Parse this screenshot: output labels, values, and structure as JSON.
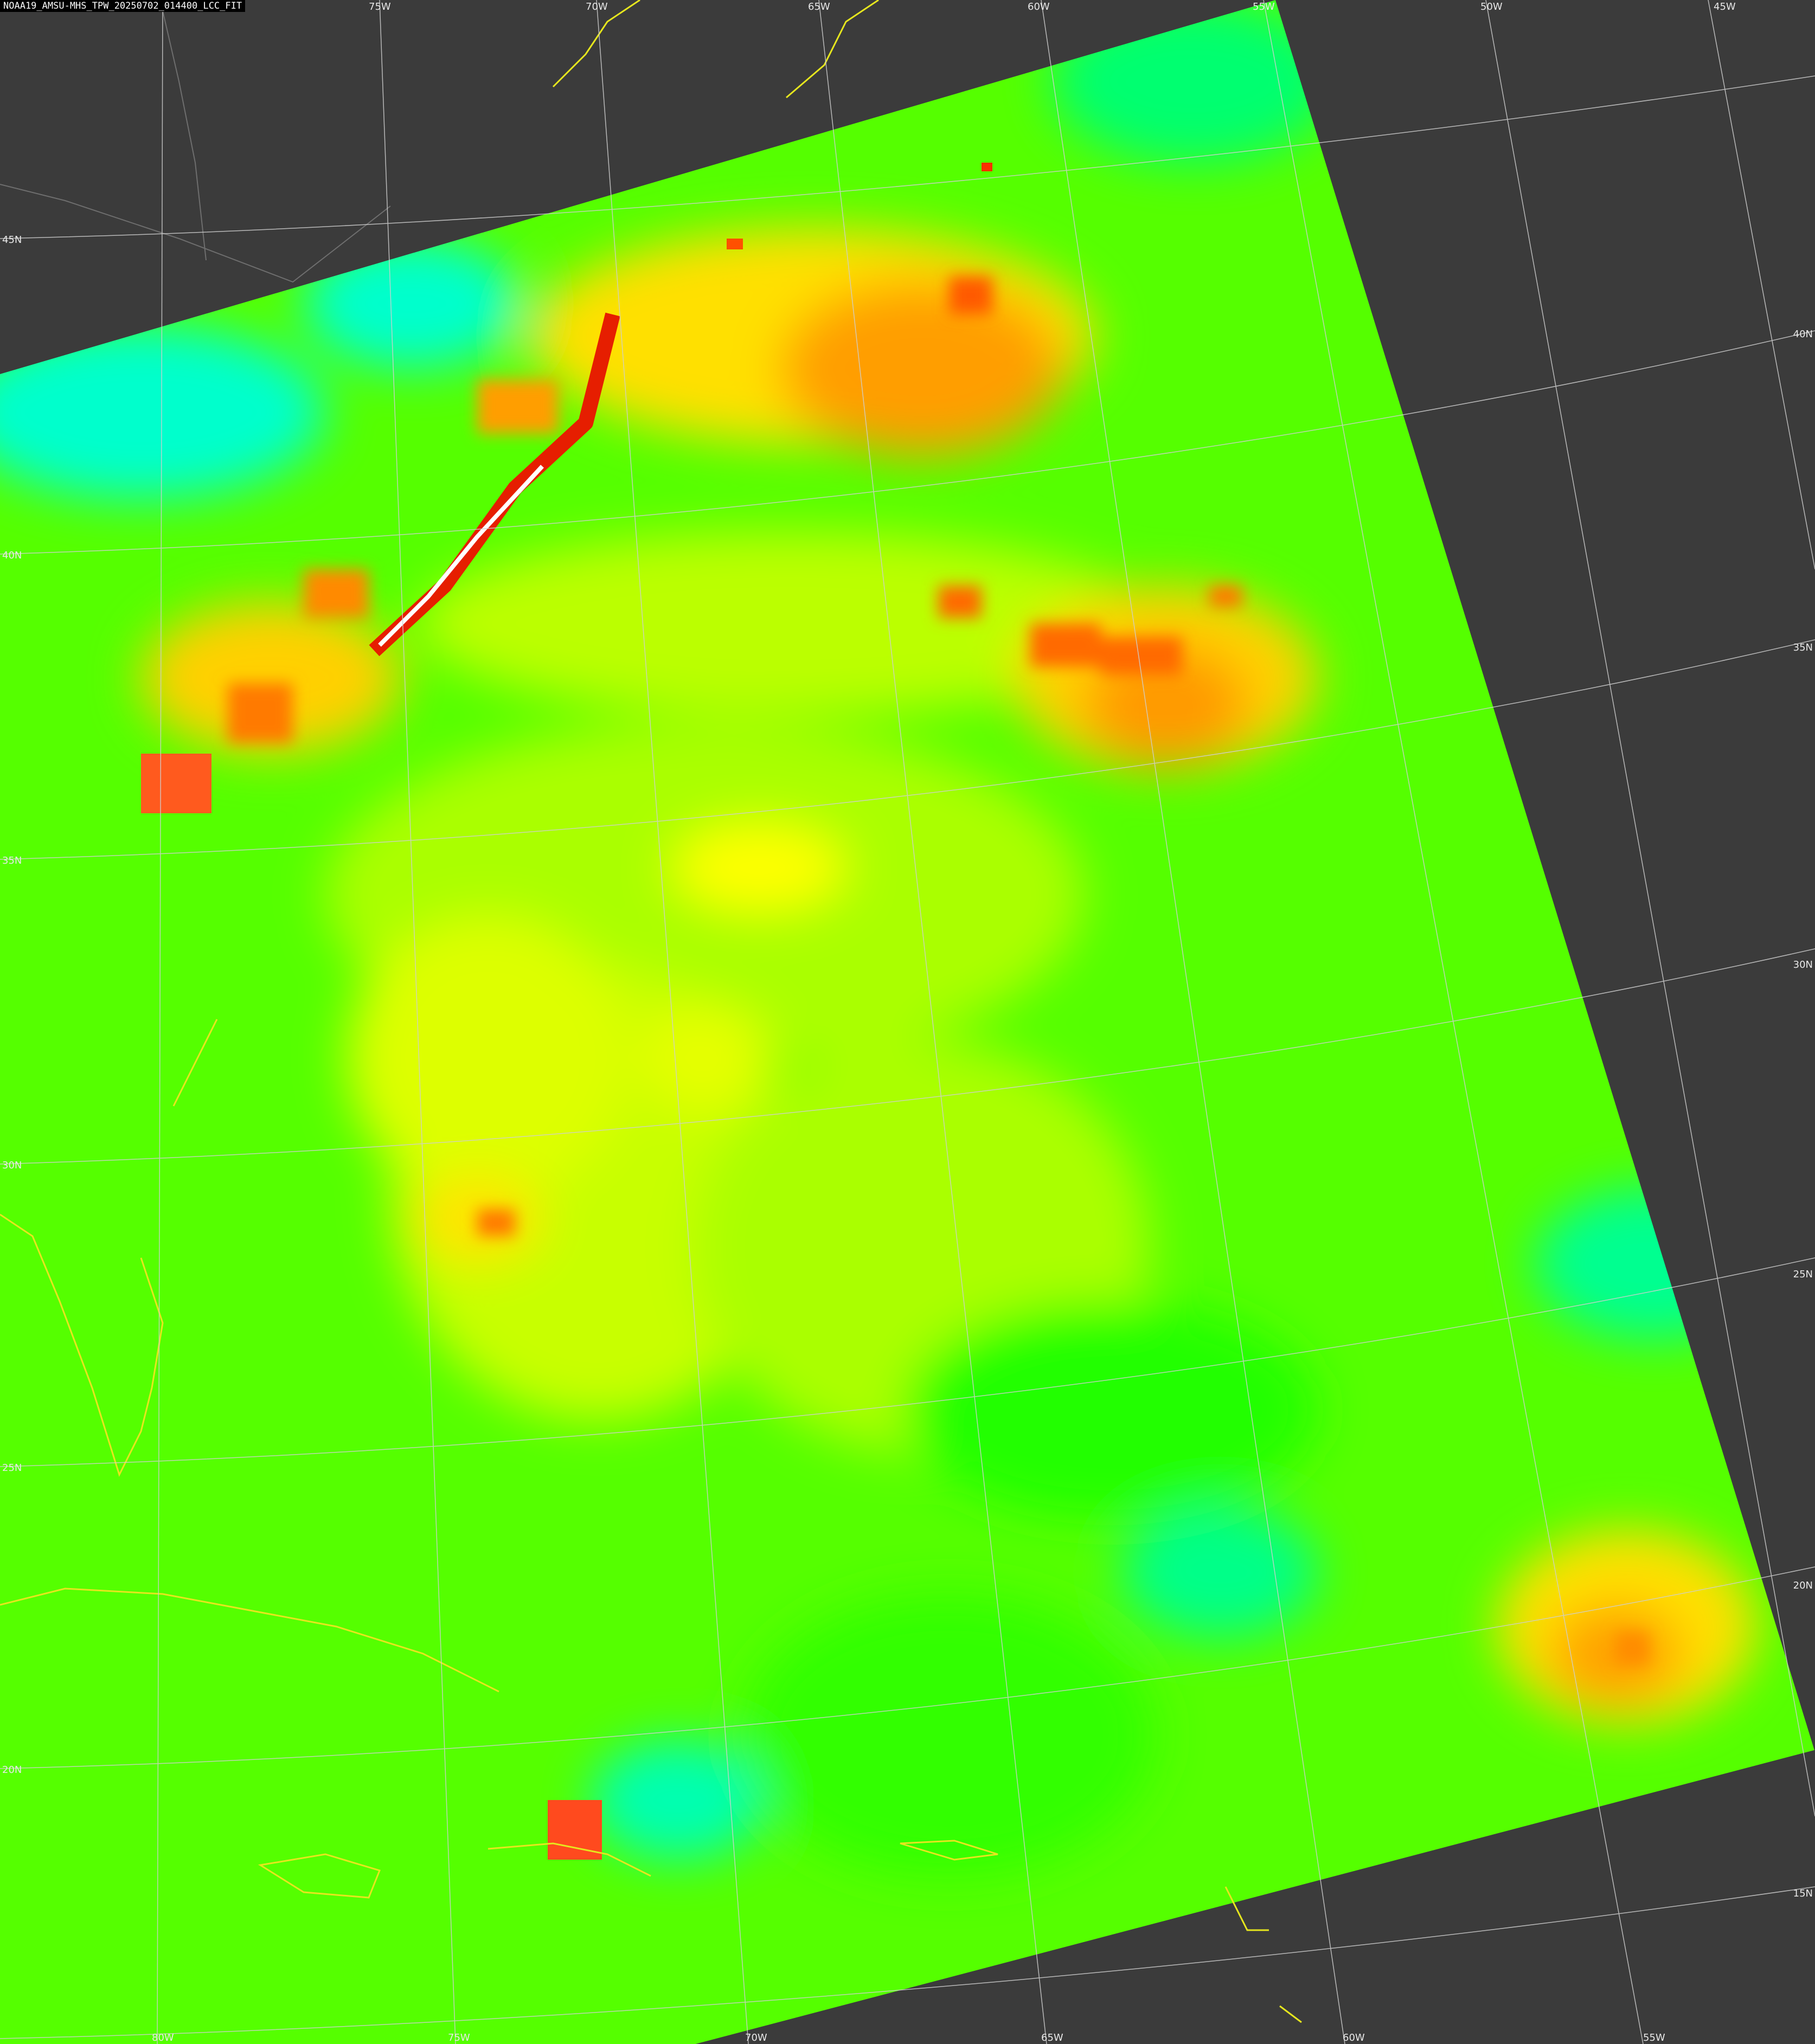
{
  "title": "NOAA19_AMSU-MHS_TPW_20250702_014400_LCC_FIT",
  "colors": {
    "background": "#3b3b3b",
    "coastline": "#e6e61e",
    "borders": "#6e6e6e",
    "graticule": "#d0d0d0",
    "tpw_low": "#00ffcc",
    "tpw_mid": "#22ff00",
    "tpw_mid_high": "#aaff00",
    "tpw_high": "#ffff00",
    "tpw_very_high": "#ff8c00",
    "tpw_extreme": "#e61e00",
    "tpw_max": "#ffffff"
  },
  "longitude_labels_top": [
    "75W",
    "70W",
    "65W",
    "60W",
    "55W",
    "50W",
    "45W"
  ],
  "longitude_labels_bottom": [
    "80W",
    "75W",
    "70W",
    "65W",
    "60W",
    "55W"
  ],
  "latitude_labels_left": [
    "45N",
    "40N",
    "35N",
    "30N",
    "25N",
    "20N"
  ],
  "latitude_labels_right": [
    "40N",
    "35N",
    "30N",
    "25N",
    "20N",
    "15N"
  ]
}
